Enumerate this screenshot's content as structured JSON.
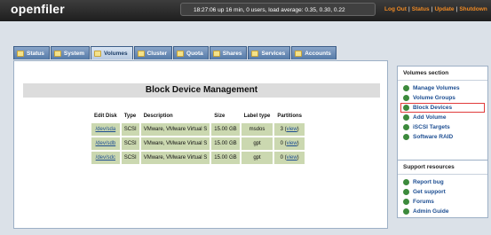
{
  "header": {
    "logo": "openfiler",
    "status": "18:27:06 up 16 min, 0 users, load average: 0.35, 0.30, 0.22",
    "links": [
      "Log Out",
      "Status",
      "Update",
      "Shutdown"
    ]
  },
  "tabs": [
    {
      "label": "Status",
      "active": false
    },
    {
      "label": "System",
      "active": false
    },
    {
      "label": "Volumes",
      "active": true
    },
    {
      "label": "Cluster",
      "active": false
    },
    {
      "label": "Quota",
      "active": false
    },
    {
      "label": "Shares",
      "active": false
    },
    {
      "label": "Services",
      "active": false
    },
    {
      "label": "Accounts",
      "active": false
    }
  ],
  "main": {
    "title": "Block Device Management",
    "table": {
      "headers": [
        "Edit Disk",
        "Type",
        "Description",
        "Size",
        "Label type",
        "Partitions"
      ],
      "rows": [
        {
          "disk": "/dev/sda",
          "type": "SCSI",
          "desc": "VMware, VMware Virtual S",
          "size": "15.00 GB",
          "label": "msdos",
          "parts": "3",
          "view": "view"
        },
        {
          "disk": "/dev/sdb",
          "type": "SCSI",
          "desc": "VMware, VMware Virtual S",
          "size": "15.00 GB",
          "label": "gpt",
          "parts": "0",
          "view": "view"
        },
        {
          "disk": "/dev/sdc",
          "type": "SCSI",
          "desc": "VMware, VMware Virtual S",
          "size": "15.00 GB",
          "label": "gpt",
          "parts": "0",
          "view": "view"
        }
      ]
    }
  },
  "volumes_section": {
    "title": "Volumes section",
    "items": [
      "Manage Volumes",
      "Volume Groups",
      "Block Devices",
      "Add Volume",
      "iSCSI Targets",
      "Software RAID"
    ],
    "selected": "Block Devices"
  },
  "support": {
    "title": "Support resources",
    "items": [
      "Report bug",
      "Get support",
      "Forums",
      "Admin Guide"
    ]
  },
  "colors": {
    "accent": "#f08a24",
    "tab": "#557aa8",
    "row": "#cbd8b0"
  }
}
